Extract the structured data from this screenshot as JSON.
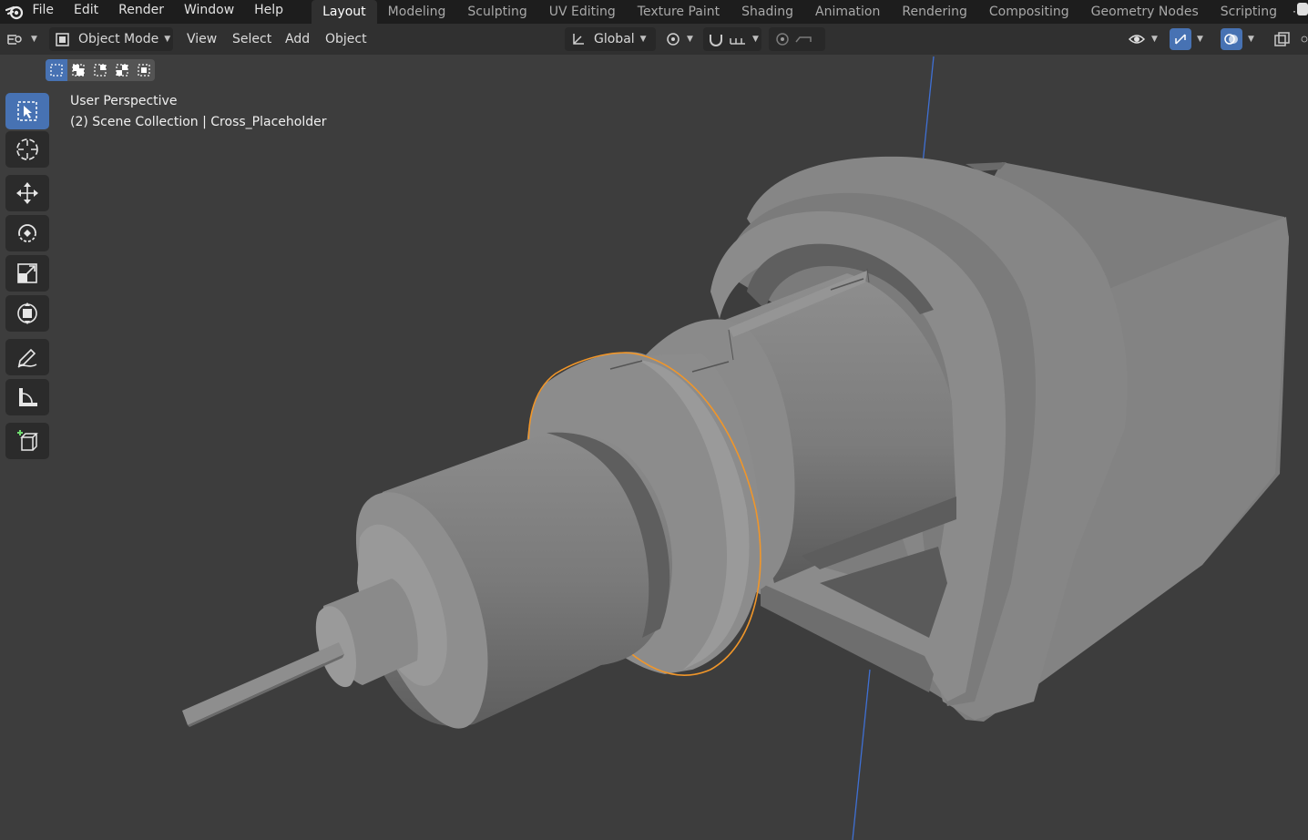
{
  "menubar": {
    "items": [
      "File",
      "Edit",
      "Render",
      "Window",
      "Help"
    ]
  },
  "workspaces": {
    "tabs": [
      "Layout",
      "Modeling",
      "Sculpting",
      "UV Editing",
      "Texture Paint",
      "Shading",
      "Animation",
      "Rendering",
      "Compositing",
      "Geometry Nodes",
      "Scripting"
    ],
    "active": "Layout",
    "add_label": "+"
  },
  "header": {
    "mode_label": "Object Mode",
    "view_label": "View",
    "select_label": "Select",
    "add_label": "Add",
    "object_label": "Object",
    "orientation_label": "Global"
  },
  "viewport": {
    "perspective_label": "User Perspective",
    "collection_label": "(2) Scene Collection | Cross_Placeholder"
  },
  "colors": {
    "accent": "#4772b3",
    "selection_outline": "#f0962a",
    "background": "#3d3d3d",
    "z_axis": "#3f70d4"
  },
  "toolbar": {
    "tools": [
      "select-box",
      "cursor",
      "move",
      "rotate",
      "scale",
      "transform",
      "annotate",
      "measure",
      "add-cube"
    ],
    "active": "select-box"
  }
}
